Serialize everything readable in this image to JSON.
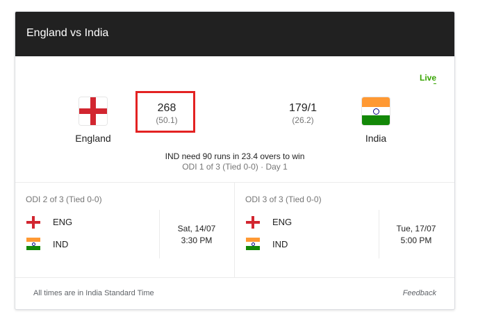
{
  "header": {
    "title": "England vs India"
  },
  "live_label": "Live",
  "match": {
    "team1": {
      "name": "England",
      "score": "268",
      "overs": "(50.1)"
    },
    "team2": {
      "name": "India",
      "score": "179/1",
      "overs": "(26.2)"
    },
    "status": "IND need 90 runs in 23.4 overs to win",
    "series_info": "ODI 1 of 3 (Tied 0-0) · Day 1"
  },
  "upcoming": [
    {
      "series": "ODI 2 of 3 (Tied 0-0)",
      "team1": "ENG",
      "team2": "IND",
      "date": "Sat, 14/07",
      "time": "3:30 PM"
    },
    {
      "series": "ODI 3 of 3 (Tied 0-0)",
      "team1": "ENG",
      "team2": "IND",
      "date": "Tue, 17/07",
      "time": "5:00 PM"
    }
  ],
  "footer": {
    "timezone_note": "All times are in India Standard Time",
    "feedback": "Feedback"
  },
  "colors": {
    "header_bg": "#212121",
    "live": "#36a300",
    "highlight": "#e32222",
    "england_red": "#d22630",
    "india_saffron": "#ff9933",
    "india_green": "#138808"
  }
}
